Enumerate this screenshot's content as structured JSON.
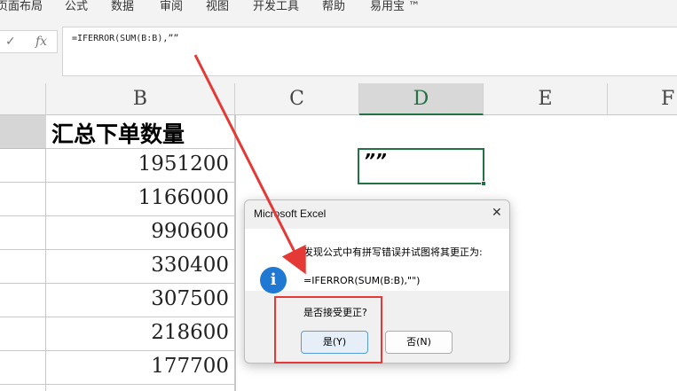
{
  "menu": {
    "items": [
      "页面布局",
      "公式",
      "数据",
      "审阅",
      "视图",
      "开发工具",
      "帮助",
      "易用宝 ™"
    ]
  },
  "formula_bar": {
    "cancel_icon": "✓",
    "fx_icon": "fx",
    "formula": "=IFERROR(SUM(B:B),””"
  },
  "columns": [
    "B",
    "C",
    "D",
    "E",
    "F"
  ],
  "sheet": {
    "b_header": "汇总下单数量",
    "b_values": [
      "1951200",
      "1166000",
      "990600",
      "330400",
      "307500",
      "218600",
      "177700"
    ],
    "d_value": "””"
  },
  "dialog": {
    "title": "Microsoft Excel",
    "close": "✕",
    "icon_glyph": "i",
    "message": "发现公式中有拼写错误并试图将其更正为:",
    "suggestion": "=IFERROR(SUM(B:B),\"\")",
    "question": "是否接受更正?",
    "yes_label": "是(Y)",
    "no_label": "否(N)"
  },
  "annotation_color": "#e53935",
  "accent_color": "#217346"
}
